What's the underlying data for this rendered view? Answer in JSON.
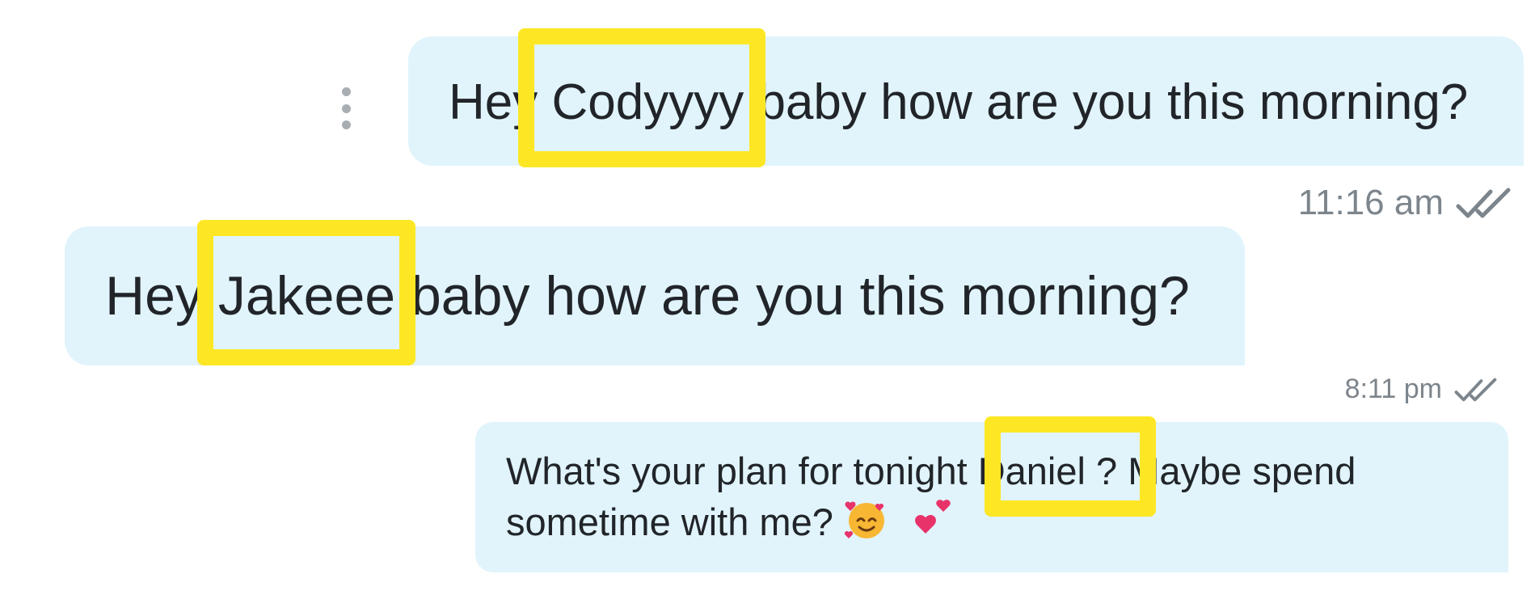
{
  "messages": [
    {
      "text": "Hey Codyyyy baby how are you this morning?",
      "time": "11:16 am",
      "status_icon": "double-check-icon"
    },
    {
      "text": "Hey Jakeee baby how are you this morning?",
      "time": "8:11 pm",
      "status_icon": "double-check-icon"
    },
    {
      "text": "What's your plan for tonight Daniel ? Maybe spend sometime with me?",
      "emojis": [
        "smiling-face-with-hearts-emoji",
        "two-hearts-emoji"
      ]
    }
  ],
  "highlight_color": "#fde725",
  "bubble_color": "#e1f4fc",
  "message_menu_icon": "vertical-dots-icon"
}
